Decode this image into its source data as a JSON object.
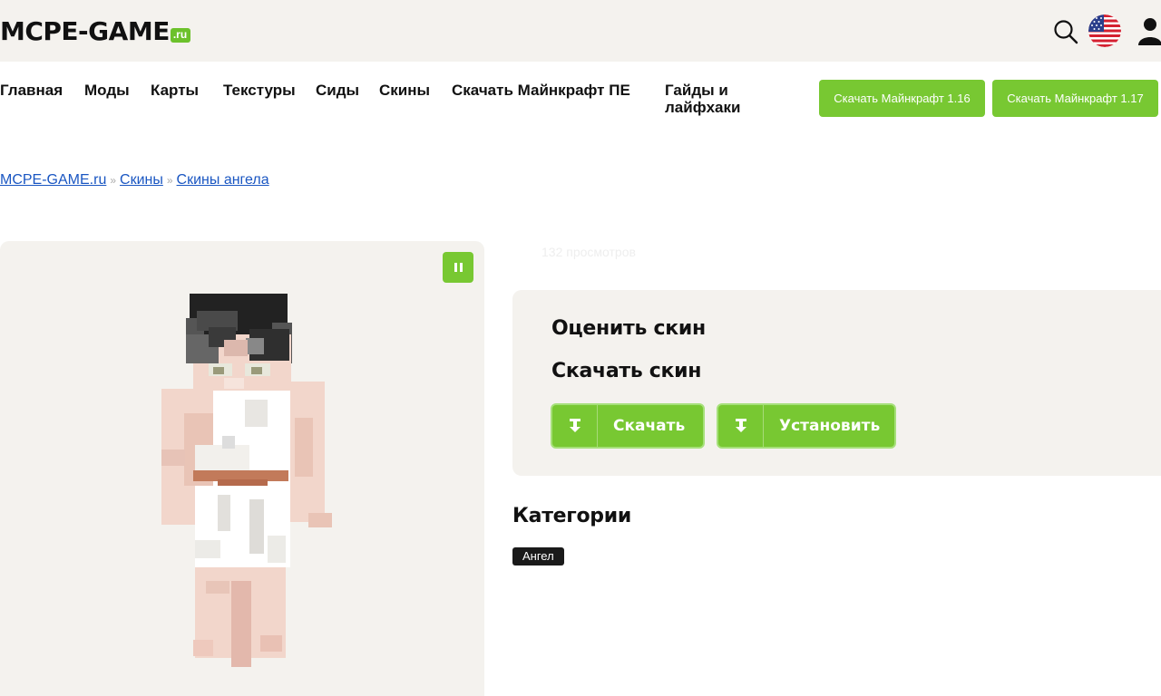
{
  "header": {
    "logo_main": "MCPE-GAME",
    "logo_tld": ".ru",
    "icons": [
      "search-icon",
      "us-flag-icon",
      "user-icon"
    ]
  },
  "nav": {
    "items": [
      {
        "label": "Главная"
      },
      {
        "label": "Моды"
      },
      {
        "label": "Карты"
      },
      {
        "label": "Текстуры"
      },
      {
        "label": "Сиды"
      },
      {
        "label": "Скины"
      },
      {
        "label": "Скачать Майнкрафт ПЕ"
      },
      {
        "label": "Гайды и лайфхаки"
      }
    ],
    "download_buttons": [
      {
        "label": "Скачать Майнкрафт 1.16"
      },
      {
        "label": "Скачать Майнкрафт 1.17"
      }
    ]
  },
  "breadcrumb": {
    "items": [
      "MCPE-GAME.ru",
      "Скины",
      "Скины ангела"
    ],
    "separator": "»"
  },
  "skin": {
    "views": "132 просмотров"
  },
  "actions": {
    "rate_title": "Оценить скин",
    "download_title": "Скачать скин",
    "download_button": "Скачать",
    "install_button": "Установить"
  },
  "categories": {
    "title": "Категории",
    "tags": [
      "Ангел"
    ]
  },
  "colors": {
    "accent_green": "#78c832",
    "panel_bg": "#f4f2ee",
    "link_blue": "#1a56c2"
  }
}
